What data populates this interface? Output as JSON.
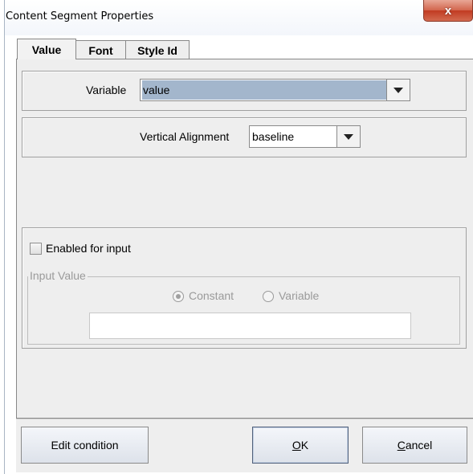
{
  "window": {
    "title": "Content Segment Properties",
    "close_glyph": "x"
  },
  "tabs": [
    {
      "label": "Value",
      "active": true
    },
    {
      "label": "Font",
      "active": false
    },
    {
      "label": "Style Id",
      "active": false
    }
  ],
  "variable": {
    "label": "Variable",
    "value": "value",
    "highlight_color": "#a3b6cc"
  },
  "vertical_alignment": {
    "label": "Vertical Alignment",
    "value": "baseline"
  },
  "input_section": {
    "enabled_label": "Enabled for input",
    "enabled_checked": false,
    "legend": "Input Value",
    "radio_constant": "Constant",
    "radio_variable": "Variable",
    "selected": "Constant",
    "value": ""
  },
  "buttons": {
    "edit_condition": "Edit condition",
    "ok_mnemonic": "O",
    "ok_rest": "K",
    "cancel_mnemonic": "C",
    "cancel_rest": "ancel"
  }
}
